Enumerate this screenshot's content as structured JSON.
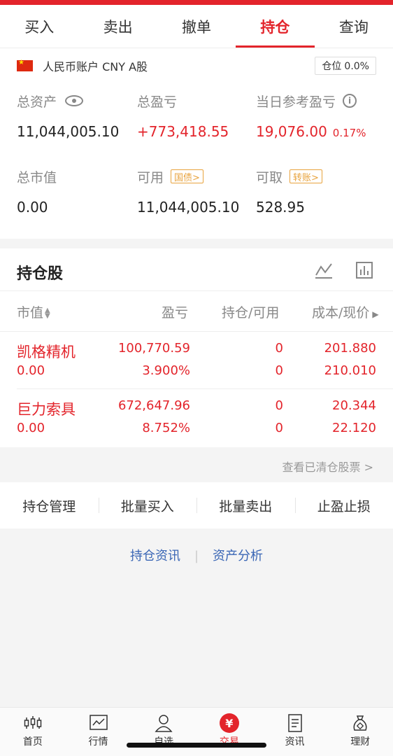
{
  "tabs": [
    "买入",
    "卖出",
    "撤单",
    "持仓",
    "查询"
  ],
  "account": {
    "name": "人民币账户 CNY A股",
    "position_label": "仓位",
    "position_value": "0.0%"
  },
  "metrics": {
    "total_assets_label": "总资产",
    "total_assets": "11,044,005.10",
    "total_pnl_label": "总盈亏",
    "total_pnl": "+773,418.55",
    "daily_pnl_label": "当日参考盈亏",
    "daily_pnl": "19,076.00",
    "daily_pnl_pct": "0.17%",
    "market_value_label": "总市值",
    "market_value": "0.00",
    "available_label": "可用",
    "available_tag": "国债>",
    "available": "11,044,005.10",
    "withdrawable_label": "可取",
    "withdrawable_tag": "转账>",
    "withdrawable": "528.95"
  },
  "holdings": {
    "title": "持仓股",
    "columns": [
      "市值",
      "盈亏",
      "持仓/可用",
      "成本/现价"
    ],
    "rows": [
      {
        "name": "凯格精机",
        "market_value": "0.00",
        "pnl": "100,770.59",
        "pnl_pct": "3.900%",
        "hold": "0",
        "available": "0",
        "cost": "201.880",
        "price": "210.010"
      },
      {
        "name": "巨力索具",
        "market_value": "0.00",
        "pnl": "672,647.96",
        "pnl_pct": "8.752%",
        "hold": "0",
        "available": "0",
        "cost": "20.344",
        "price": "22.120"
      }
    ],
    "cleared_link": "查看已清仓股票 >"
  },
  "actions": [
    "持仓管理",
    "批量买入",
    "批量卖出",
    "止盈止损"
  ],
  "links": [
    "持仓资讯",
    "资产分析"
  ],
  "nav": [
    "首页",
    "行情",
    "自选",
    "交易",
    "资讯",
    "理财"
  ],
  "colors": {
    "accent": "#e3242b",
    "link": "#3a66b5",
    "tag": "#e8a33d"
  }
}
